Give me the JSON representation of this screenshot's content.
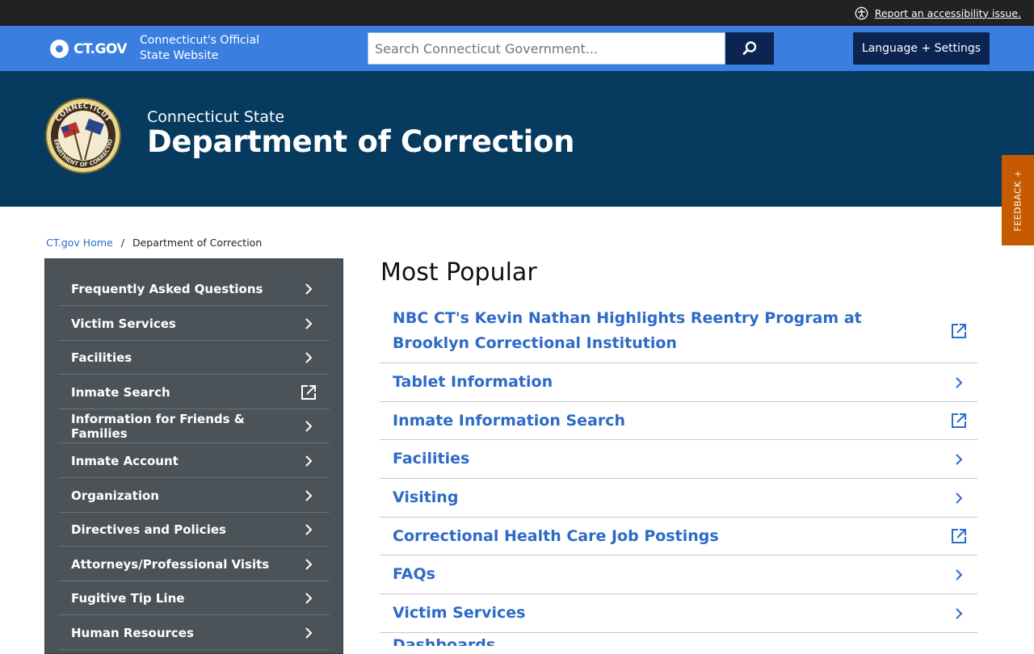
{
  "utility": {
    "accessibility_text": "Report an accessibility issue."
  },
  "header": {
    "logo_text": "CT.GOV",
    "official_line1": "Connecticut's Official",
    "official_line2": "State Website",
    "search_placeholder": "Search Connecticut Government...",
    "language_button": "Language + Settings"
  },
  "banner": {
    "pre_title": "Connecticut State",
    "title": "Department of Correction",
    "seal_text_top": "CONNECTICUT",
    "seal_text_bottom": "DEPARTMENT OF CORRECTION"
  },
  "feedback": {
    "label": "FEEDBACK +"
  },
  "breadcrumb": {
    "home": "CT.gov Home",
    "separator": "/",
    "current": "Department of Correction"
  },
  "sidebar": {
    "items": [
      {
        "label": "Frequently Asked Questions",
        "icon": "chevron-right-icon"
      },
      {
        "label": "Victim Services",
        "icon": "chevron-right-icon"
      },
      {
        "label": "Facilities",
        "icon": "chevron-right-icon"
      },
      {
        "label": "Inmate Search",
        "icon": "external-link-icon"
      },
      {
        "label": "Information for Friends & Families",
        "icon": "chevron-right-icon"
      },
      {
        "label": "Inmate Account",
        "icon": "chevron-right-icon"
      },
      {
        "label": "Organization",
        "icon": "chevron-right-icon"
      },
      {
        "label": "Directives and Policies",
        "icon": "chevron-right-icon"
      },
      {
        "label": "Attorneys/Professional Visits",
        "icon": "chevron-right-icon"
      },
      {
        "label": "Fugitive Tip Line",
        "icon": "chevron-right-icon"
      },
      {
        "label": "Human Resources",
        "icon": "chevron-right-icon"
      }
    ]
  },
  "popular": {
    "title": "Most Popular",
    "items": [
      {
        "label": "NBC CT's Kevin Nathan Highlights Reentry Program at Brooklyn Correctional Institution",
        "icon": "external-link-icon"
      },
      {
        "label": "Tablet Information",
        "icon": "chevron-right-icon"
      },
      {
        "label": "Inmate Information Search",
        "icon": "external-link-icon"
      },
      {
        "label": "Facilities",
        "icon": "chevron-right-icon"
      },
      {
        "label": "Visiting",
        "icon": "chevron-right-icon"
      },
      {
        "label": "Correctional Health Care Job Postings",
        "icon": "external-link-icon"
      },
      {
        "label": "FAQs",
        "icon": "chevron-right-icon"
      },
      {
        "label": "Victim Services",
        "icon": "chevron-right-icon"
      },
      {
        "label": "Dashboards",
        "icon": "chevron-right-icon"
      }
    ]
  },
  "colors": {
    "utility_bar": "#222222",
    "ctgov_blue": "#3a7ee0",
    "navy": "#0b2451",
    "banner": "#063a5e",
    "sidebar": "#4c5358",
    "link": "#2d6bc7",
    "feedback": "#c65a00"
  }
}
